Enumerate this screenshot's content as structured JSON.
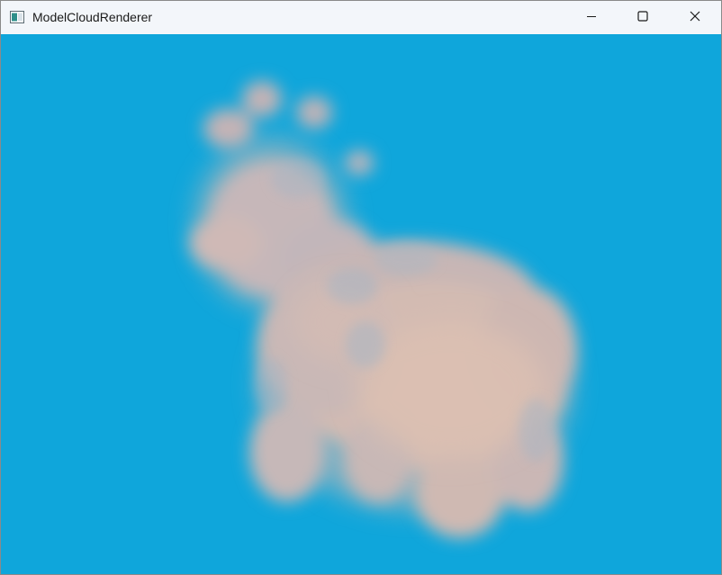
{
  "window": {
    "title": "ModelCloudRenderer"
  },
  "titlebar": {
    "app_icon": "app-window-icon",
    "minimize_icon": "minimize-icon",
    "maximize_icon": "maximize-icon",
    "close_icon": "close-icon"
  },
  "viewport": {
    "background_color": "#0fa6db",
    "cloud_color": "#d9bdb4",
    "cloud_shade_color": "#b7b9c2",
    "subject": "cow-model-cloud"
  }
}
